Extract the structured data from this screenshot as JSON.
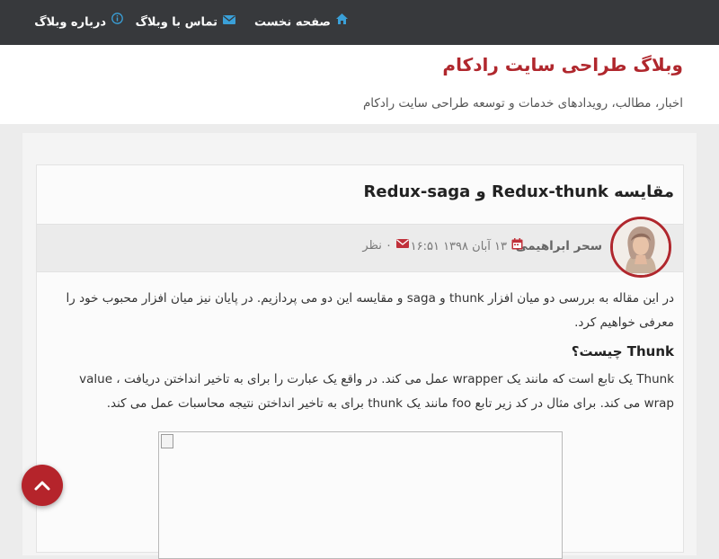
{
  "nav": {
    "home_label": "صفحه نخست",
    "contact_label": "تماس با وبلاگ",
    "about_label": "درباره وبلاگ"
  },
  "header": {
    "title": "وبلاگ طراحی سایت رادکام",
    "description": "اخبار، مطالب، رویدادهای خدمات و توسعه طراحی سایت رادکام"
  },
  "post": {
    "title": "مقایسه Redux-thunk و Redux-saga",
    "author": "سحر ابراهیمی",
    "date": "۱۳ آبان ۱۳۹۸ ۱۶:۵۱",
    "comments": "۰ نظر",
    "intro": "در این مقاله به بررسی دو میان افزار thunk و saga و مقایسه این دو می پردازیم. در پایان نیز میان افزار محبوب خود را معرفی خواهیم کرد.",
    "section_heading": "Thunk چیست؟",
    "section_text": "Thunk یک تابع است که مانند یک wrapper عمل می کند. در واقع یک عبارت را برای به تاخیر انداختن دریافت value ، wrap می کند. برای مثال در کد زیر تابع foo مانند یک thunk برای به تاخیر انداختن نتیجه محاسبات عمل می کند."
  },
  "icons": {
    "home": "home-icon",
    "contact": "envelope-icon",
    "about": "info-icon",
    "date": "calendar-icon",
    "comments": "envelope-icon",
    "fab": "chevron-up-icon"
  },
  "colors": {
    "topbar": "#37393c",
    "accent": "#b0272d",
    "icon_blue": "#3aa0d8"
  }
}
